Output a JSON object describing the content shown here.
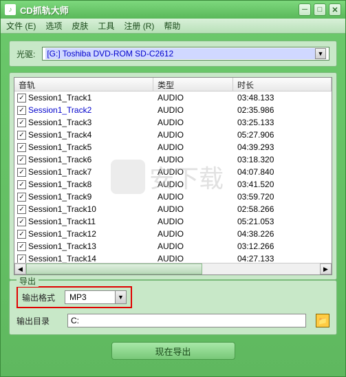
{
  "window": {
    "title": "CD抓轨大师"
  },
  "menu": [
    "文件 (E)",
    "选项",
    "皮肤",
    "工具",
    "注册 (R)",
    "帮助"
  ],
  "drive": {
    "label": "光驱:",
    "value": "[G:] Toshiba  DVD-ROM SD-C2612"
  },
  "tracks": {
    "columns": {
      "track": "音轨",
      "type": "类型",
      "duration": "时长"
    },
    "rows": [
      {
        "checked": true,
        "name": "Session1_Track1",
        "type": "AUDIO",
        "duration": "03:48.133",
        "selected": false
      },
      {
        "checked": true,
        "name": "Session1_Track2",
        "type": "AUDIO",
        "duration": "02:35.986",
        "selected": true
      },
      {
        "checked": true,
        "name": "Session1_Track3",
        "type": "AUDIO",
        "duration": "03:25.133",
        "selected": false
      },
      {
        "checked": true,
        "name": "Session1_Track4",
        "type": "AUDIO",
        "duration": "05:27.906",
        "selected": false
      },
      {
        "checked": true,
        "name": "Session1_Track5",
        "type": "AUDIO",
        "duration": "04:39.293",
        "selected": false
      },
      {
        "checked": true,
        "name": "Session1_Track6",
        "type": "AUDIO",
        "duration": "03:18.320",
        "selected": false
      },
      {
        "checked": true,
        "name": "Session1_Track7",
        "type": "AUDIO",
        "duration": "04:07.840",
        "selected": false
      },
      {
        "checked": true,
        "name": "Session1_Track8",
        "type": "AUDIO",
        "duration": "03:41.520",
        "selected": false
      },
      {
        "checked": true,
        "name": "Session1_Track9",
        "type": "AUDIO",
        "duration": "03:59.720",
        "selected": false
      },
      {
        "checked": true,
        "name": "Session1_Track10",
        "type": "AUDIO",
        "duration": "02:58.266",
        "selected": false
      },
      {
        "checked": true,
        "name": "Session1_Track11",
        "type": "AUDIO",
        "duration": "05:21.053",
        "selected": false
      },
      {
        "checked": true,
        "name": "Session1_Track12",
        "type": "AUDIO",
        "duration": "04:38.226",
        "selected": false
      },
      {
        "checked": true,
        "name": "Session1_Track13",
        "type": "AUDIO",
        "duration": "03:12.266",
        "selected": false
      },
      {
        "checked": true,
        "name": "Session1_Track14",
        "type": "AUDIO",
        "duration": "04:27.133",
        "selected": false
      }
    ]
  },
  "output": {
    "legend": "导出",
    "format_label": "输出格式",
    "format_value": "MP3",
    "dir_label": "输出目录",
    "dir_value": "C:",
    "export_button": "现在导出"
  },
  "watermark": "安下载"
}
